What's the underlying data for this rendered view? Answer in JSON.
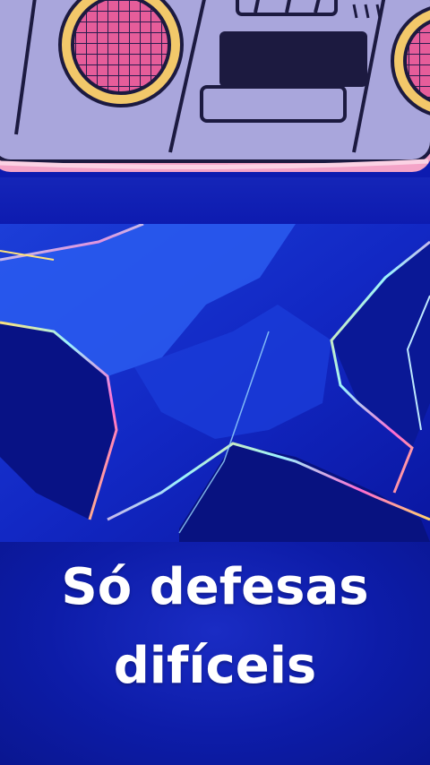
{
  "video": {
    "caption_line1": "Só defesas",
    "caption_line2": "difíceis"
  },
  "colors": {
    "background": "#0b1a9c",
    "boombox_body": "#a9a6dc",
    "speaker_ring": "#f2c86a",
    "speaker_mesh": "#e65d9a",
    "pink_edge": "#f4a4c8",
    "caption": "#ffffff"
  },
  "icons": {
    "boombox": "boombox-illustration",
    "background": "neon-star-shapes"
  }
}
